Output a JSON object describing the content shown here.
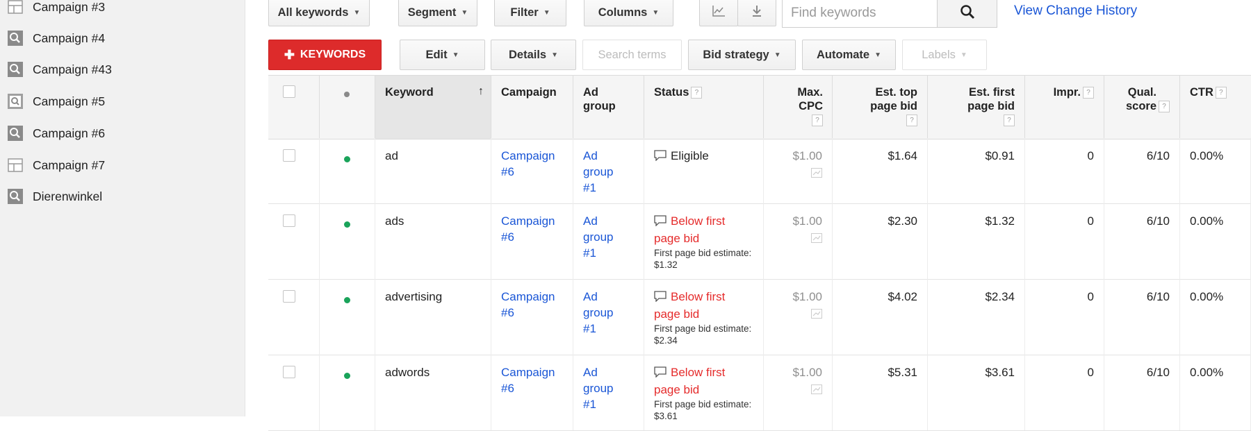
{
  "sidebar": {
    "items": [
      {
        "label": "Campaign #3",
        "icon": "display-campaign-icon"
      },
      {
        "label": "Campaign #4",
        "icon": "search-campaign-icon"
      },
      {
        "label": "Campaign #43",
        "icon": "search-campaign-icon"
      },
      {
        "label": "Campaign #5",
        "icon": "search-display-campaign-icon"
      },
      {
        "label": "Campaign #6",
        "icon": "search-campaign-icon"
      },
      {
        "label": "Campaign #7",
        "icon": "display-campaign-icon"
      },
      {
        "label": "Dierenwinkel",
        "icon": "search-campaign-icon"
      }
    ]
  },
  "toolbar": {
    "all_keywords": "All keywords",
    "segment": "Segment",
    "filter": "Filter",
    "columns": "Columns",
    "search_placeholder": "Find keywords",
    "view_history": "View Change History",
    "add_keywords": "KEYWORDS",
    "edit": "Edit",
    "details": "Details",
    "search_terms": "Search terms",
    "bid_strategy": "Bid strategy",
    "automate": "Automate",
    "labels": "Labels"
  },
  "table": {
    "headers": {
      "keyword": "Keyword",
      "campaign": "Campaign",
      "ad_group": "Ad group",
      "status": "Status",
      "max_cpc": "Max. CPC",
      "est_top": "Est. top page bid",
      "est_first": "Est. first page bid",
      "impr": "Impr.",
      "qual": "Qual. score",
      "ctr": "CTR"
    },
    "rows": [
      {
        "keyword": "ad",
        "campaign": "Campaign #6",
        "ad_group": "Ad group #1",
        "status": "Eligible",
        "status_detail": "",
        "max_cpc": "$1.00",
        "est_top": "$1.64",
        "est_first": "$0.91",
        "impr": "0",
        "qual": "6/10",
        "ctr": "0.00%"
      },
      {
        "keyword": "ads",
        "campaign": "Campaign #6",
        "ad_group": "Ad group #1",
        "status": "Below first page bid",
        "status_detail": "First page bid estimate: $1.32",
        "max_cpc": "$1.00",
        "est_top": "$2.30",
        "est_first": "$1.32",
        "impr": "0",
        "qual": "6/10",
        "ctr": "0.00%"
      },
      {
        "keyword": "advertising",
        "campaign": "Campaign #6",
        "ad_group": "Ad group #1",
        "status": "Below first page bid",
        "status_detail": "First page bid estimate: $2.34",
        "max_cpc": "$1.00",
        "est_top": "$4.02",
        "est_first": "$2.34",
        "impr": "0",
        "qual": "6/10",
        "ctr": "0.00%"
      },
      {
        "keyword": "adwords",
        "campaign": "Campaign #6",
        "ad_group": "Ad group #1",
        "status": "Below first page bid",
        "status_detail": "First page bid estimate: $3.61",
        "max_cpc": "$1.00",
        "est_top": "$5.31",
        "est_first": "$3.61",
        "impr": "0",
        "qual": "6/10",
        "ctr": "0.00%"
      }
    ]
  },
  "colors": {
    "primary_red": "#dd2b2b",
    "link_blue": "#1a56d6",
    "status_red": "#e52b2b",
    "enabled_green": "#1aa35a"
  }
}
